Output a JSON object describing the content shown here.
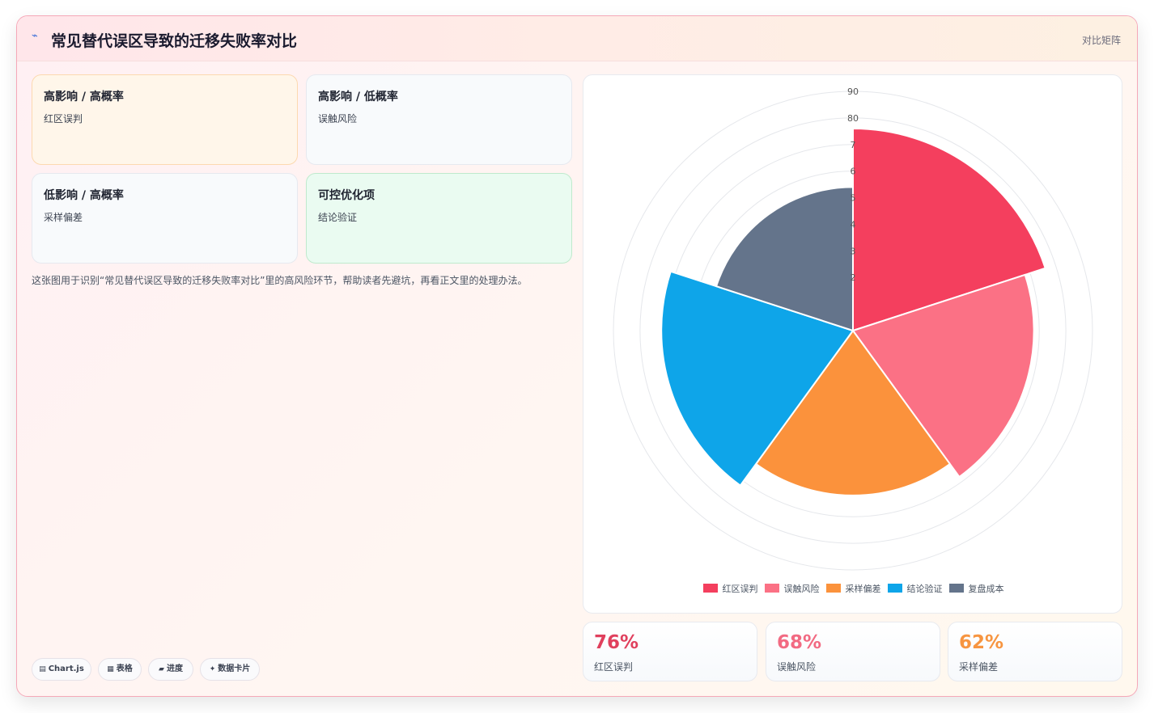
{
  "header": {
    "icon": "lightning-icon",
    "title": "常见替代误区导致的迁移失败率对比",
    "right_label": "对比矩阵"
  },
  "quadrants": [
    {
      "title": "高影响 / 高概率",
      "item": "红区误判"
    },
    {
      "title": "高影响 / 低概率",
      "item": "误触风险"
    },
    {
      "title": "低影响 / 高概率",
      "item": "采样偏差"
    },
    {
      "title": "可控优化项",
      "item": "结论验证"
    }
  ],
  "description": "这张图用于识别“常见替代误区导致的迁移失败率对比”里的高风险环节，帮助读者先避坑，再看正文里的处理办法。",
  "tags": [
    {
      "icon": "▤",
      "label": "Chart.js"
    },
    {
      "icon": "▦",
      "label": "表格"
    },
    {
      "icon": "▰",
      "label": "进度"
    },
    {
      "icon": "✦",
      "label": "数据卡片"
    }
  ],
  "chart_data": {
    "type": "polarArea",
    "categories": [
      "红区误判",
      "误触风险",
      "采样偏差",
      "结论验证",
      "复盘成本"
    ],
    "values": [
      76,
      68,
      62,
      72,
      54
    ],
    "colors": [
      "#f43f5e",
      "#fb7185",
      "#fb923c",
      "#0ea5e9",
      "#64748b"
    ],
    "r_range": [
      0,
      90
    ],
    "r_ticks": [
      0,
      10,
      20,
      30,
      40,
      50,
      60,
      70,
      80,
      90
    ],
    "visible_tick_labels": [
      "90",
      "80",
      "7",
      "6",
      "5",
      "4",
      "3",
      "2"
    ],
    "grid": true,
    "legend_position": "bottom"
  },
  "stats": [
    {
      "value": "76%",
      "label": "红区误判",
      "color": "#e0405d"
    },
    {
      "value": "68%",
      "label": "误触风险",
      "color": "#f26a82"
    },
    {
      "value": "62%",
      "label": "采样偏差",
      "color": "#f79540"
    }
  ]
}
